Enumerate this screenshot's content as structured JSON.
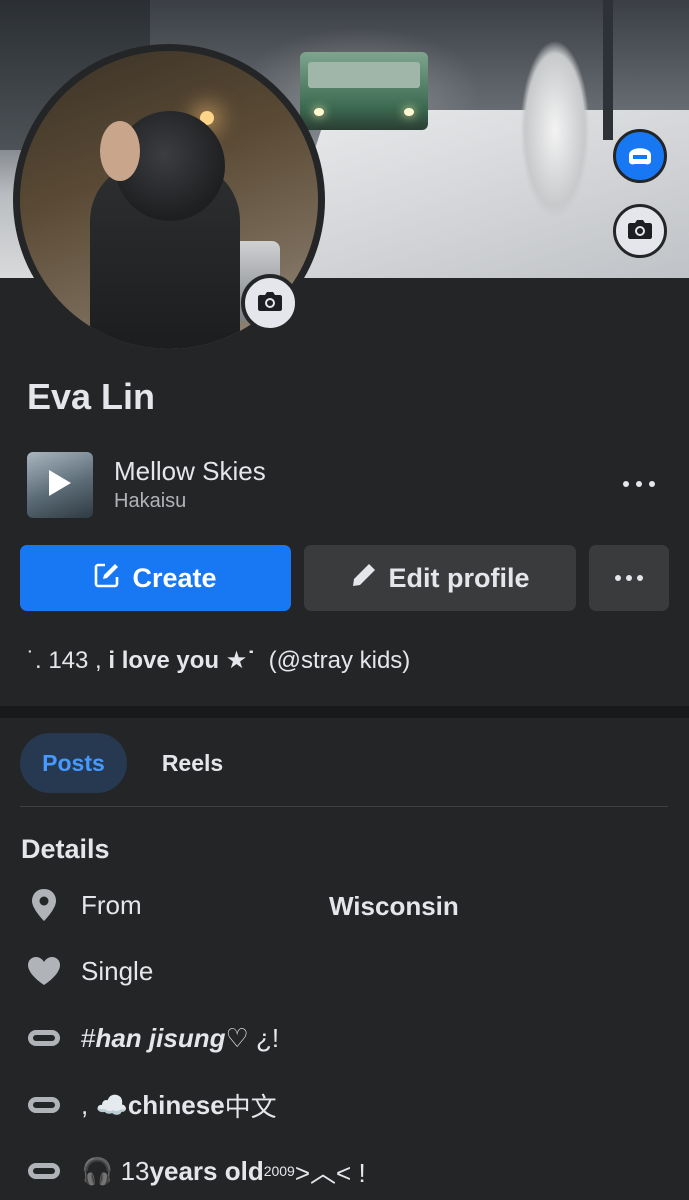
{
  "profile": {
    "name": "Eva Lin",
    "bio_prefix": "˙. 143 , ",
    "bio_bold": "i love you ★˙",
    "bio_suffix": "  (@stray kids)"
  },
  "music": {
    "title": "Mellow Skies",
    "artist": "Hakaisu"
  },
  "actions": {
    "create_label": "Create",
    "edit_label": "Edit profile"
  },
  "tabs": [
    {
      "label": "Posts",
      "active": true
    },
    {
      "label": "Reels",
      "active": false
    }
  ],
  "details": {
    "title": "Details",
    "from_label": "From",
    "from_value": "Wisconsin",
    "relationship": "Single",
    "line1_prefix": "# ",
    "line1_bold": "han jisung",
    "line1_suffix": " ♡ ¿!",
    "line2_prefix": ", ☁️ ",
    "line2_bold": "chinese",
    "line2_suffix": " 中文",
    "line3_prefix": "🎧 13 ",
    "line3_bold": "years old",
    "line3_sup": "2009",
    "line3_suffix": " >︿< !"
  },
  "colors": {
    "accent": "#1877f2",
    "background": "#242526",
    "secondary_button": "#3a3b3c",
    "tab_active_bg": "#263951",
    "tab_active_text": "#4599ff"
  },
  "icons": [
    "avatar-icon",
    "camera-icon",
    "play-icon",
    "more-icon",
    "edit-icon",
    "pencil-icon",
    "location-icon",
    "heart-icon",
    "pill-icon"
  ]
}
